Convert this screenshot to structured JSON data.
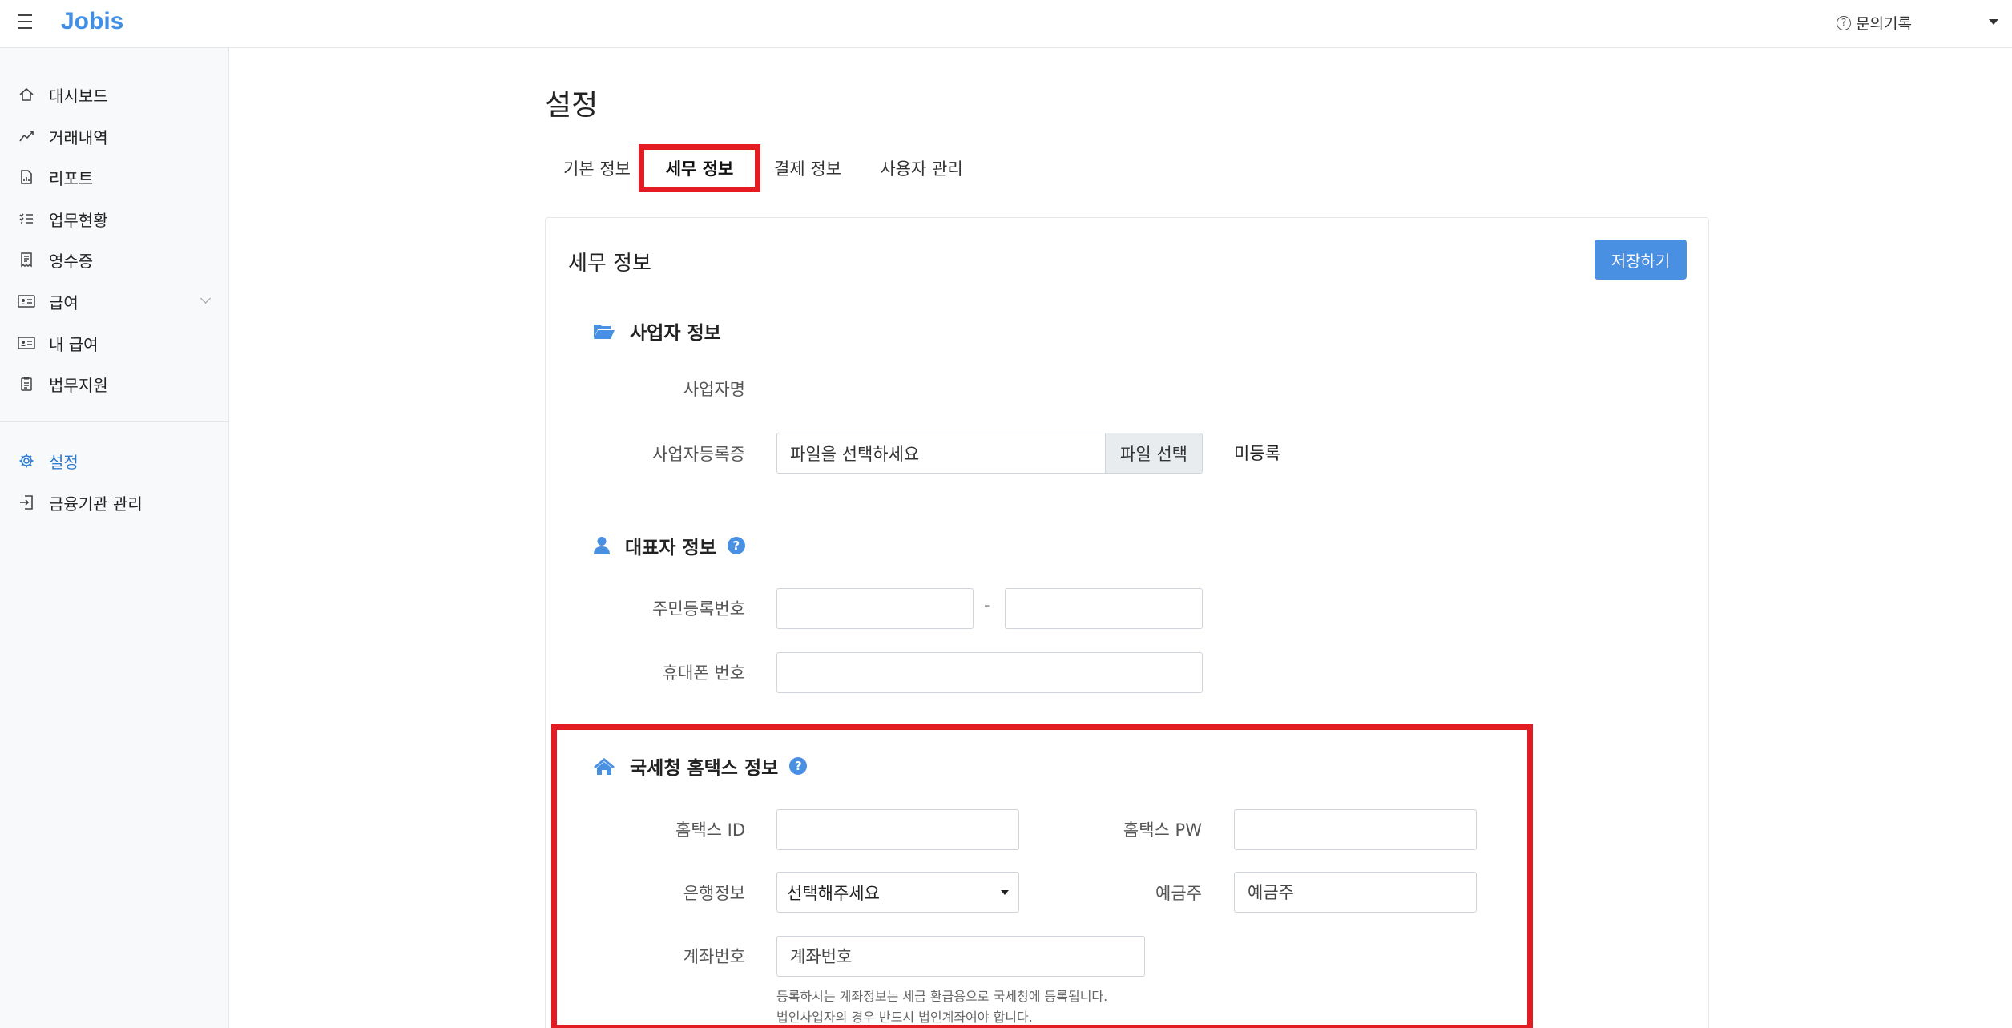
{
  "header": {
    "brand": "Jobis",
    "help_label": "문의기록"
  },
  "sidebar": {
    "items": [
      {
        "label": "대시보드",
        "icon": "home-icon"
      },
      {
        "label": "거래내역",
        "icon": "chart-line-icon"
      },
      {
        "label": "리포트",
        "icon": "report-file-icon"
      },
      {
        "label": "업무현황",
        "icon": "task-list-icon"
      },
      {
        "label": "영수증",
        "icon": "receipt-icon"
      },
      {
        "label": "급여",
        "icon": "id-card-icon"
      },
      {
        "label": "내 급여",
        "icon": "id-card-icon"
      },
      {
        "label": "법무지원",
        "icon": "clipboard-icon"
      },
      {
        "label": "설정",
        "icon": "gear-icon"
      },
      {
        "label": "금융기관 관리",
        "icon": "sign-in-icon"
      }
    ]
  },
  "page": {
    "title": "설정",
    "tabs": [
      {
        "label": "기본 정보"
      },
      {
        "label": "세무 정보"
      },
      {
        "label": "결제 정보"
      },
      {
        "label": "사용자 관리"
      }
    ]
  },
  "card": {
    "title": "세무 정보",
    "save_label": "저장하기",
    "business": {
      "heading": "사업자 정보",
      "name_label": "사업자명",
      "cert_label": "사업자등록증",
      "file_placeholder": "파일을 선택하세요",
      "file_button": "파일 선택",
      "status": "미등록"
    },
    "representative": {
      "heading": "대표자 정보",
      "rrn_label": "주민등록번호",
      "rrn_separator": "-",
      "phone_label": "휴대폰 번호"
    },
    "hometax": {
      "heading": "국세청 홈택스 정보",
      "id_label": "홈택스 ID",
      "pw_label": "홈택스 PW",
      "bank_label": "은행정보",
      "bank_selected": "선택해주세요",
      "holder_label": "예금주",
      "holder_placeholder": "예금주",
      "account_label": "계좌번호",
      "account_placeholder": "계좌번호",
      "help_line1": "등록하시는 계좌정보는 세금 환급용으로 국세청에 등록됩니다.",
      "help_line2": "법인사업자의 경우 반드시 법인계좌여야 합니다."
    }
  },
  "colors": {
    "brand": "#3f8fe6",
    "primary_button": "#4a90e2",
    "highlight": "#e31c23"
  }
}
